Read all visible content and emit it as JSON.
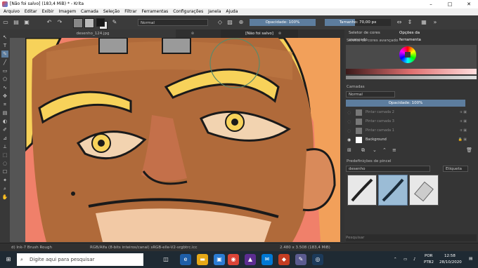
{
  "window": {
    "title": "[Não foi salvo]  (183,4 MiB)  * - Krita",
    "minimize": "–",
    "maximize": "□",
    "close": "✕"
  },
  "menu": [
    "Arquivo",
    "Editar",
    "Exibir",
    "Imagem",
    "Camada",
    "Seleção",
    "Filtrar",
    "Ferramentas",
    "Configurações",
    "Janela",
    "Ajuda"
  ],
  "toolbar": {
    "blend_mode": "Normal",
    "opacity": "Opacidade: 100%",
    "size": "Tamanho: 70,00 px",
    "fg_color": "#1a1a1a",
    "bg_color": "#e8e8e8"
  },
  "tabs": {
    "doc1": "desenho_124.jpg",
    "doc2": "[Não foi salvo]"
  },
  "docker": {
    "tab_selector": "Seletor de cores avançado",
    "tab_options": "Opções da ferramenta",
    "selector_title": "Seletor de cores avançado",
    "layers_title": "Camadas",
    "layers_blend": "Normal",
    "layers_opacity": "Opacidade:  100%",
    "layers": [
      {
        "name": "Pintar camada 2"
      },
      {
        "name": "Pintar camada 3"
      },
      {
        "name": "Pintar camada 1"
      },
      {
        "name": "Background"
      }
    ],
    "presets_title": "Predefinições de pincel",
    "presets_filter": "desenho",
    "presets_tag": "Etiqueta",
    "search_placeholder": "Pesquisar"
  },
  "status": {
    "brush": "d) Ink-7 Brush Rough",
    "color_space": "RGB/Alfa (8-bits inteiros/canal)  sRGB-elle-V2-srgbtrc.icc",
    "dimensions": "2.480 x 3.508 (183,4 MiB)"
  },
  "taskbar": {
    "search_placeholder": "Digite aqui para pesquisar",
    "lang": "POR",
    "lang2": "PTB2",
    "time": "12:58",
    "date": "28/10/2020"
  }
}
